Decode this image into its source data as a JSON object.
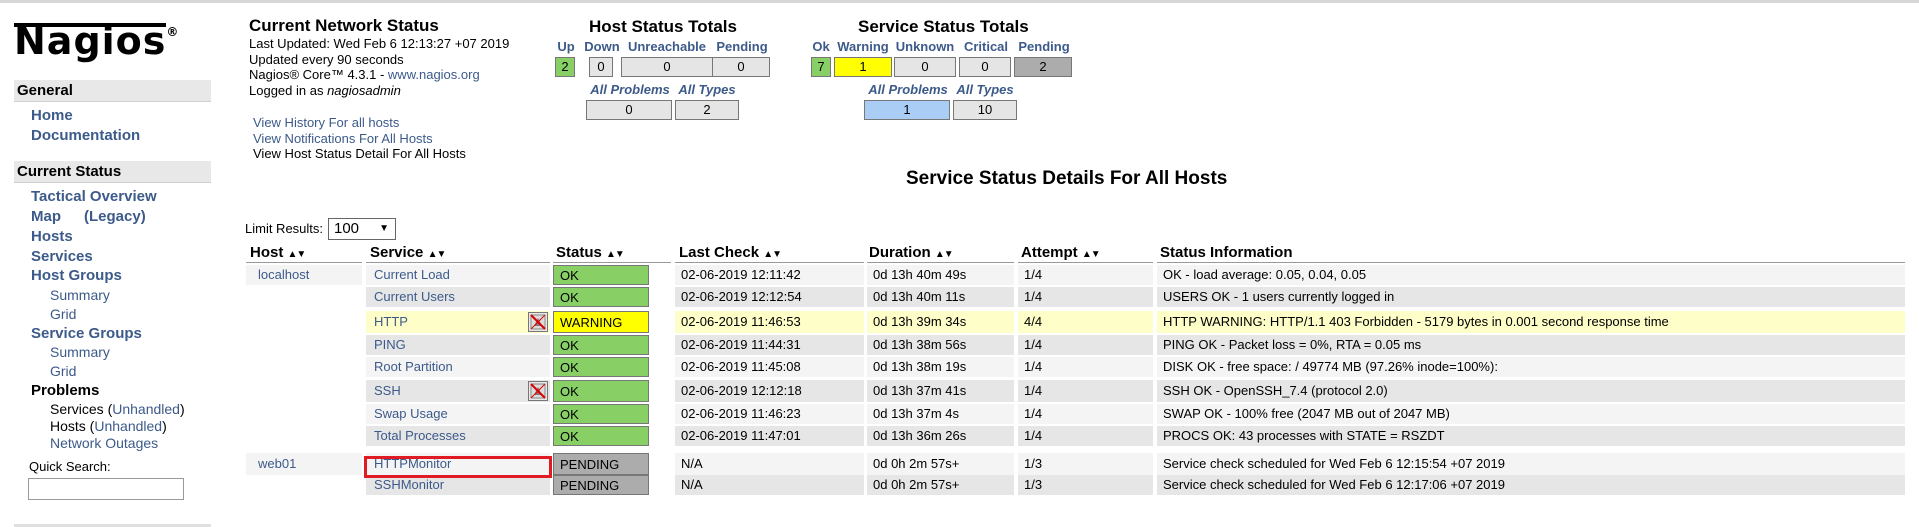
{
  "sidebar": {
    "logo": "Nagios",
    "logo_mark": "®",
    "general_head": "General",
    "home": "Home",
    "documentation": "Documentation",
    "current_status_head": "Current Status",
    "tactical_overview": "Tactical Overview",
    "map": "Map",
    "legacy": "(Legacy)",
    "hosts": "Hosts",
    "services": "Services",
    "host_groups": "Host Groups",
    "hg_summary": "Summary",
    "hg_grid": "Grid",
    "service_groups": "Service Groups",
    "sg_summary": "Summary",
    "sg_grid": "Grid",
    "problems": "Problems",
    "services_unhandled_pre": "Services (",
    "services_unhandled_link": "Unhandled",
    "services_unhandled_post": ")",
    "hosts_unhandled_pre": "Hosts (",
    "hosts_unhandled_link": "Unhandled",
    "hosts_unhandled_post": ")",
    "network_outages": "Network Outages",
    "quick_search": "Quick Search:"
  },
  "info": {
    "title": "Current Network Status",
    "last_updated": "Last Updated: Wed Feb 6 12:13:27 +07 2019",
    "updated_every": "Updated every 90 seconds",
    "core_pre": "Nagios® Core™ 4.3.1 - ",
    "core_link": "www.nagios.org",
    "logged_pre": "Logged in as ",
    "logged_user": "nagiosadmin",
    "view_history": "View History For all hosts",
    "view_notifications": "View Notifications For All Hosts",
    "view_host_detail": "View Host Status Detail For All Hosts"
  },
  "host_totals": {
    "title": "Host Status Totals",
    "headers": [
      "Up",
      "Down",
      "Unreachable",
      "Pending"
    ],
    "values": [
      "2",
      "0",
      "0",
      "0"
    ],
    "problem_headers": [
      "All Problems",
      "All Types"
    ],
    "problem_values": [
      "0",
      "2"
    ]
  },
  "service_totals": {
    "title": "Service Status Totals",
    "headers": [
      "Ok",
      "Warning",
      "Unknown",
      "Critical",
      "Pending"
    ],
    "values": [
      "7",
      "1",
      "0",
      "0",
      "2"
    ],
    "problem_headers": [
      "All Problems",
      "All Types"
    ],
    "problem_values": [
      "1",
      "10"
    ]
  },
  "main_title": "Service Status Details For All Hosts",
  "limit": {
    "label": "Limit Results:",
    "value": "100"
  },
  "table": {
    "columns": [
      "Host",
      "Service",
      "Status",
      "Last Check",
      "Duration",
      "Attempt",
      "Status Information"
    ],
    "sort_glyph": "▲▼",
    "rows": [
      {
        "host": "localhost",
        "service": "Current Load",
        "status": "OK",
        "last_check": "02-06-2019 12:11:42",
        "duration": "0d 13h 40m 49s",
        "attempt": "1/4",
        "info": "OK - load average: 0.05, 0.04, 0.05"
      },
      {
        "host": "",
        "service": "Current Users",
        "status": "OK",
        "last_check": "02-06-2019 12:12:54",
        "duration": "0d 13h 40m 11s",
        "attempt": "1/4",
        "info": "USERS OK - 1 users currently logged in"
      },
      {
        "host": "",
        "service": "HTTP",
        "status": "WARNING",
        "last_check": "02-06-2019 11:46:53",
        "duration": "0d 13h 39m 34s",
        "attempt": "4/4",
        "info": "HTTP WARNING: HTTP/1.1 403 Forbidden - 5179 bytes in 0.001 second response time"
      },
      {
        "host": "",
        "service": "PING",
        "status": "OK",
        "last_check": "02-06-2019 11:44:31",
        "duration": "0d 13h 38m 56s",
        "attempt": "1/4",
        "info": "PING OK - Packet loss = 0%, RTA = 0.05 ms"
      },
      {
        "host": "",
        "service": "Root Partition",
        "status": "OK",
        "last_check": "02-06-2019 11:45:08",
        "duration": "0d 13h 38m 19s",
        "attempt": "1/4",
        "info": "DISK OK - free space: / 49774 MB (97.26% inode=100%):"
      },
      {
        "host": "",
        "service": "SSH",
        "status": "OK",
        "last_check": "02-06-2019 12:12:18",
        "duration": "0d 13h 37m 41s",
        "attempt": "1/4",
        "info": "SSH OK - OpenSSH_7.4 (protocol 2.0)"
      },
      {
        "host": "",
        "service": "Swap Usage",
        "status": "OK",
        "last_check": "02-06-2019 11:46:23",
        "duration": "0d 13h 37m 4s",
        "attempt": "1/4",
        "info": "SWAP OK - 100% free (2047 MB out of 2047 MB)"
      },
      {
        "host": "",
        "service": "Total Processes",
        "status": "OK",
        "last_check": "02-06-2019 11:47:01",
        "duration": "0d 13h 36m 26s",
        "attempt": "1/4",
        "info": "PROCS OK: 43 processes with STATE = RSZDT"
      },
      {
        "host": "web01",
        "service": "HTTPMonitor",
        "status": "PENDING",
        "last_check": "N/A",
        "duration": "0d 0h 2m 57s+",
        "attempt": "1/3",
        "info": "Service check scheduled for Wed Feb 6 12:15:54 +07 2019"
      },
      {
        "host": "",
        "service": "SSHMonitor",
        "status": "PENDING",
        "last_check": "N/A",
        "duration": "0d 0h 2m 57s+",
        "attempt": "1/3",
        "info": "Service check scheduled for Wed Feb 6 12:17:06 +07 2019"
      }
    ]
  },
  "colors": {
    "ok": "#88d066",
    "warning": "#ffff00",
    "pending": "#acacac",
    "problem_highlight": "#aacdf5",
    "link": "#3c5a8a",
    "selection_outline": "#e01b24"
  },
  "icons": {
    "notifications_disabled": "notifications-disabled-icon"
  }
}
